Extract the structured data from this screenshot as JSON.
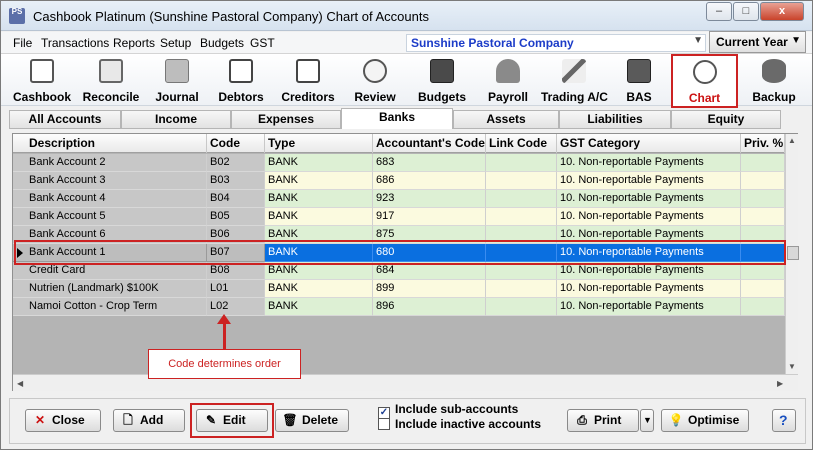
{
  "window": {
    "app_icon_label": "PS",
    "title": "Cashbook Platinum (Sunshine Pastoral Company)  Chart of Accounts",
    "minimize": "–",
    "maximize": "□",
    "close": "x"
  },
  "menu": [
    "File",
    "Transactions",
    "Reports",
    "Setup",
    "Budgets",
    "GST"
  ],
  "company_select": {
    "value": "Sunshine Pastoral Company"
  },
  "year_select": {
    "value": "Current Year"
  },
  "toolbar": [
    {
      "label": "Cashbook",
      "icon": "cashbook-icon"
    },
    {
      "label": "Reconcile",
      "icon": "reconcile-icon"
    },
    {
      "label": "Journal",
      "icon": "journal-icon"
    },
    {
      "label": "Debtors",
      "icon": "debtors-icon"
    },
    {
      "label": "Creditors",
      "icon": "creditors-icon"
    },
    {
      "label": "Review",
      "icon": "review-icon"
    },
    {
      "label": "Budgets",
      "icon": "budgets-icon"
    },
    {
      "label": "Payroll",
      "icon": "payroll-icon"
    },
    {
      "label": "Trading A/C",
      "icon": "trading-icon"
    },
    {
      "label": "BAS",
      "icon": "bas-icon"
    },
    {
      "label": "Chart",
      "icon": "chart-icon",
      "active": true
    },
    {
      "label": "Backup",
      "icon": "backup-icon"
    }
  ],
  "tabs": [
    "All Accounts",
    "Income",
    "Expenses",
    "Banks",
    "Assets",
    "Liabilities",
    "Equity"
  ],
  "active_tab": "Banks",
  "table": {
    "columns": [
      "Description",
      "Code",
      "Type",
      "Accountant's Code",
      "Link Code",
      "GST Category",
      "Priv. %"
    ],
    "rows": [
      {
        "description": "Bank Account 2",
        "code": "B02",
        "type": "BANK",
        "acc_code": "683",
        "link": "",
        "gst": "10. Non-reportable Payments",
        "priv": ""
      },
      {
        "description": "Bank Account 3",
        "code": "B03",
        "type": "BANK",
        "acc_code": "686",
        "link": "",
        "gst": "10. Non-reportable Payments",
        "priv": ""
      },
      {
        "description": "Bank Account 4",
        "code": "B04",
        "type": "BANK",
        "acc_code": "923",
        "link": "",
        "gst": "10. Non-reportable Payments",
        "priv": ""
      },
      {
        "description": "Bank Account 5",
        "code": "B05",
        "type": "BANK",
        "acc_code": "917",
        "link": "",
        "gst": "10. Non-reportable Payments",
        "priv": ""
      },
      {
        "description": "Bank Account 6",
        "code": "B06",
        "type": "BANK",
        "acc_code": "875",
        "link": "",
        "gst": "10. Non-reportable Payments",
        "priv": ""
      },
      {
        "description": "Bank  Account 1",
        "code": "B07",
        "type": "BANK",
        "acc_code": "680",
        "link": "",
        "gst": "10. Non-reportable Payments",
        "priv": "",
        "selected": true
      },
      {
        "description": "Credit Card",
        "code": "B08",
        "type": "BANK",
        "acc_code": "684",
        "link": "",
        "gst": "10. Non-reportable Payments",
        "priv": ""
      },
      {
        "description": "Nutrien (Landmark) $100K",
        "code": "L01",
        "type": "BANK",
        "acc_code": "899",
        "link": "",
        "gst": "10. Non-reportable Payments",
        "priv": ""
      },
      {
        "description": "Namoi Cotton - Crop Term",
        "code": "L02",
        "type": "BANK",
        "acc_code": "896",
        "link": "",
        "gst": "10. Non-reportable Payments",
        "priv": ""
      }
    ]
  },
  "annotation": {
    "text": "Code determines order"
  },
  "buttons": {
    "close": "Close",
    "add": "Add",
    "edit": "Edit",
    "delete": "Delete",
    "print": "Print",
    "optimise": "Optimise",
    "help": "?"
  },
  "checkboxes": {
    "include_sub": {
      "label": "Include sub-accounts",
      "checked": true
    },
    "include_inactive": {
      "label": "Include inactive accounts",
      "checked": false
    }
  },
  "colors": {
    "selected_row": "#0a6fe0",
    "row_green": "#ddf0d4",
    "row_yellow": "#fbfadf",
    "desc_grey": "#c7c7c7",
    "highlight_red": "#cc2222",
    "company_blue": "#1c3cc8"
  }
}
